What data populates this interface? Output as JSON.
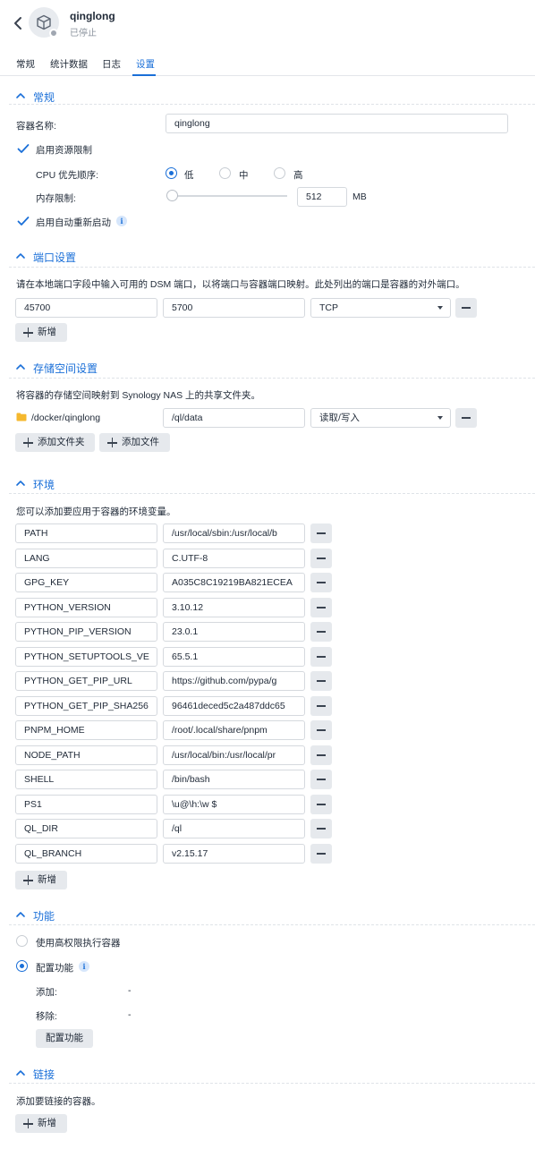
{
  "header": {
    "app_name": "qinglong",
    "status": "已停止"
  },
  "tabs": [
    {
      "label": "常规"
    },
    {
      "label": "统计数据"
    },
    {
      "label": "日志"
    },
    {
      "label": "设置"
    }
  ],
  "general": {
    "title": "常规",
    "container_name_label": "容器名称:",
    "container_name_value": "qinglong",
    "resource_limit_label": "启用资源限制",
    "cpu_label": "CPU 优先顺序:",
    "cpu_options": [
      "低",
      "中",
      "高"
    ],
    "cpu_selected": "低",
    "memory_label": "内存限制:",
    "memory_value": "512",
    "memory_unit": "MB",
    "auto_restart_label": "启用自动重新启动"
  },
  "ports": {
    "title": "端口设置",
    "description": "请在本地端口字段中输入可用的 DSM 端口，以将端口与容器端口映射。此处列出的端口是容器的对外端口。",
    "rows": [
      {
        "local": "45700",
        "container": "5700",
        "protocol": "TCP"
      }
    ],
    "add_label": "新增"
  },
  "storage": {
    "title": "存储空间设置",
    "description": "将容器的存储空间映射到 Synology NAS 上的共享文件夹。",
    "rows": [
      {
        "folder": "/docker/qinglong",
        "mount": "/ql/data",
        "mode": "读取/写入"
      }
    ],
    "add_folder_label": "添加文件夹",
    "add_file_label": "添加文件"
  },
  "env": {
    "title": "环境",
    "description": "您可以添加要应用于容器的环境变量。",
    "vars": [
      {
        "key": "PATH",
        "value": "/usr/local/sbin:/usr/local/b"
      },
      {
        "key": "LANG",
        "value": "C.UTF-8"
      },
      {
        "key": "GPG_KEY",
        "value": "A035C8C19219BA821ECEA"
      },
      {
        "key": "PYTHON_VERSION",
        "value": "3.10.12"
      },
      {
        "key": "PYTHON_PIP_VERSION",
        "value": "23.0.1"
      },
      {
        "key": "PYTHON_SETUPTOOLS_VE",
        "value": "65.5.1"
      },
      {
        "key": "PYTHON_GET_PIP_URL",
        "value": "https://github.com/pypa/g"
      },
      {
        "key": "PYTHON_GET_PIP_SHA256",
        "value": "96461deced5c2a487ddc65"
      },
      {
        "key": "PNPM_HOME",
        "value": "/root/.local/share/pnpm"
      },
      {
        "key": "NODE_PATH",
        "value": "/usr/local/bin:/usr/local/pr"
      },
      {
        "key": "SHELL",
        "value": "/bin/bash"
      },
      {
        "key": "PS1",
        "value": "\\u@\\h:\\w $"
      },
      {
        "key": "QL_DIR",
        "value": "/ql"
      },
      {
        "key": "QL_BRANCH",
        "value": "v2.15.17"
      }
    ],
    "add_label": "新增"
  },
  "capabilities": {
    "title": "功能",
    "privileged_label": "使用高权限执行容器",
    "configure_label": "配置功能",
    "add_label": "添加:",
    "add_value": "-",
    "remove_label": "移除:",
    "remove_value": "-",
    "configure_button": "配置功能"
  },
  "links": {
    "title": "链接",
    "description": "添加要链接的容器。",
    "add_label": "新增"
  },
  "colors": {
    "accent": "#1a6fd8",
    "button_bg": "#e6e9ed",
    "border": "#d5d9de"
  }
}
